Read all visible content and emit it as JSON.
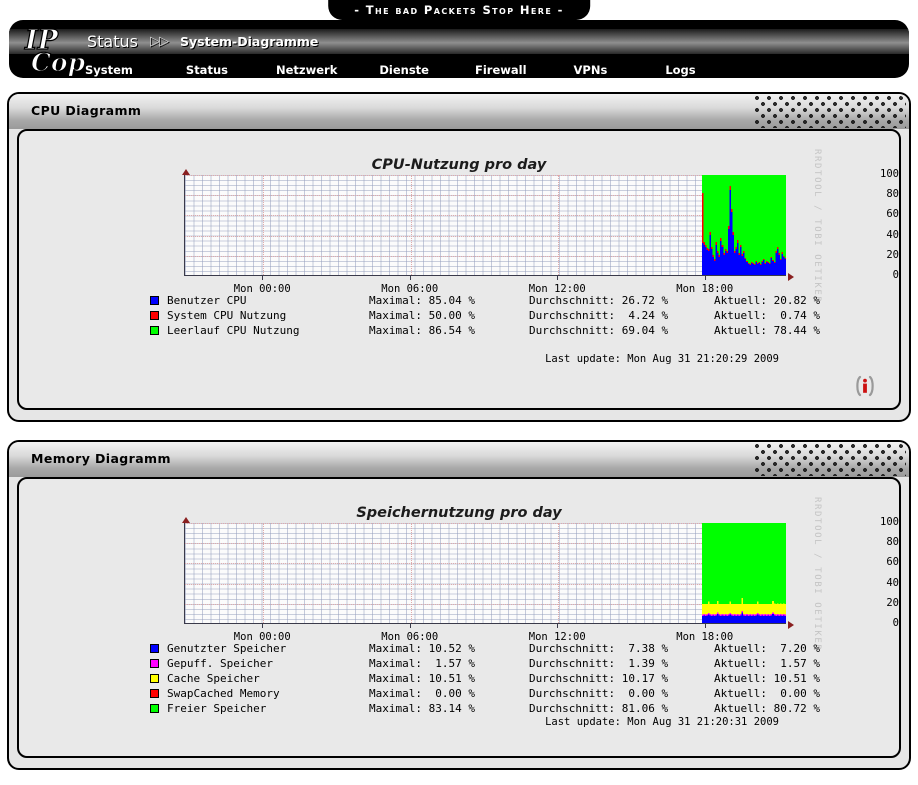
{
  "banner": {
    "tagline": "- The bad Packets Stop Here -"
  },
  "header": {
    "logo_top": "IP",
    "logo_bottom": "Cop",
    "breadcrumb_section": "Status",
    "breadcrumb_separator": "▷▷",
    "breadcrumb_page": "System-Diagramme",
    "nav": [
      {
        "label": "System"
      },
      {
        "label": "Status"
      },
      {
        "label": "Netzwerk"
      },
      {
        "label": "Dienste"
      },
      {
        "label": "Firewall"
      },
      {
        "label": "VPNs"
      },
      {
        "label": "Logs"
      }
    ]
  },
  "panels": [
    {
      "id": "cpu",
      "title": "CPU Diagramm",
      "watermark": "RRDTOOL / TOBI OETIKER",
      "last_update": "Last update: Mon Aug 31 21:20:29 2009",
      "has_info_icon": true
    },
    {
      "id": "memory",
      "title": "Memory Diagramm",
      "watermark": "RRDTOOL / TOBI OETIKER",
      "last_update": "Last update: Mon Aug 31 21:20:31 2009",
      "has_info_icon": false
    }
  ],
  "chart_data": [
    {
      "type": "area",
      "id": "cpu",
      "title": "CPU-Nutzung pro day",
      "xlabel": "",
      "ylabel": "",
      "ylim": [
        0,
        100
      ],
      "yticks": [
        0,
        20,
        40,
        60,
        80,
        100
      ],
      "xticks": [
        "Mon 00:00",
        "Mon 06:00",
        "Mon 12:00",
        "Mon 18:00"
      ],
      "xtick_positions_pct": [
        13.0,
        37.5,
        62.0,
        86.5
      ],
      "grid": true,
      "legend_position": "below",
      "legend_columns": [
        "",
        "Maximal",
        "Durchschnitt",
        "Aktuell"
      ],
      "series": [
        {
          "name": "Benutzer CPU",
          "color": "#0000ff",
          "max": "85.04",
          "avg": "26.72",
          "cur": "20.82",
          "unit": "%",
          "values": [
            32,
            30,
            28,
            25,
            24,
            40,
            26,
            18,
            14,
            30,
            22,
            18,
            34,
            28,
            20,
            24,
            22,
            46,
            85,
            63,
            40,
            22,
            26,
            32,
            20,
            28,
            19,
            22,
            16,
            13,
            11,
            10,
            12,
            11,
            10,
            13,
            11,
            12,
            10,
            13,
            15,
            11,
            13,
            12,
            11,
            17,
            14,
            12,
            22,
            26,
            20,
            15,
            21,
            18,
            16
          ]
        },
        {
          "name": "System CPU Nutzung",
          "color": "#ff0000",
          "max": "50.00",
          "avg": "4.24",
          "cur": "0.74",
          "unit": "%",
          "values": [
            50,
            3,
            2,
            2,
            2,
            3,
            2,
            2,
            2,
            3,
            2,
            2,
            3,
            2,
            2,
            2,
            2,
            3,
            4,
            3,
            3,
            2,
            2,
            3,
            2,
            2,
            2,
            2,
            1,
            1,
            1,
            1,
            1,
            1,
            1,
            1,
            1,
            1,
            1,
            1,
            1,
            1,
            1,
            1,
            1,
            1,
            1,
            1,
            2,
            2,
            2,
            1,
            2,
            1,
            1
          ]
        },
        {
          "name": "Leerlauf CPU Nutzung",
          "color": "#00ff00",
          "max": "86.54",
          "avg": "69.04",
          "cur": "78.44",
          "unit": "%",
          "values": [
            18,
            67,
            70,
            73,
            74,
            57,
            72,
            80,
            84,
            67,
            76,
            80,
            63,
            70,
            78,
            74,
            76,
            51,
            11,
            34,
            57,
            76,
            72,
            65,
            78,
            70,
            79,
            76,
            83,
            86,
            88,
            89,
            87,
            88,
            89,
            86,
            88,
            87,
            89,
            86,
            84,
            88,
            86,
            87,
            88,
            82,
            85,
            87,
            76,
            72,
            78,
            84,
            77,
            81,
            83
          ]
        }
      ],
      "data_start_pct": 86.0,
      "data_end_pct": 100.0
    },
    {
      "type": "area",
      "id": "memory",
      "title": "Speichernutzung pro day",
      "xlabel": "",
      "ylabel": "",
      "ylim": [
        0,
        100
      ],
      "yticks": [
        0,
        20,
        40,
        60,
        80,
        100
      ],
      "xticks": [
        "Mon 00:00",
        "Mon 06:00",
        "Mon 12:00",
        "Mon 18:00"
      ],
      "xtick_positions_pct": [
        13.0,
        37.5,
        62.0,
        86.5
      ],
      "grid": true,
      "legend_position": "below",
      "legend_columns": [
        "",
        "Maximal",
        "Durchschnitt",
        "Aktuell"
      ],
      "series": [
        {
          "name": "Genutzter Speicher",
          "color": "#0000ff",
          "max": "10.52",
          "avg": "7.38",
          "cur": "7.20",
          "unit": "%",
          "values": [
            7.2,
            7.3,
            7.2,
            7.4,
            8.6,
            7.3,
            7.2,
            7.3,
            7.2,
            7.4,
            8.8,
            7.3,
            7.2,
            7.3,
            7.2,
            7.3,
            7.2,
            7.4,
            8.7,
            7.3,
            7.2,
            7.3,
            7.2,
            7.3,
            7.2,
            7.4,
            10.5,
            7.3,
            7.2,
            7.3,
            7.2,
            7.3,
            7.2,
            7.3,
            7.2,
            7.4,
            8.6,
            7.3,
            7.2,
            7.3,
            7.2,
            7.3,
            7.2,
            7.3,
            7.2,
            7.4,
            8.9,
            7.3,
            7.2,
            7.3,
            7.2,
            7.3,
            7.2,
            7.3,
            7.2
          ]
        },
        {
          "name": "Gepuff. Speicher",
          "color": "#ff00ff",
          "max": "1.57",
          "avg": "1.39",
          "cur": "1.57",
          "unit": "%",
          "values": [
            1.5,
            1.5,
            1.5,
            1.5,
            1.5,
            1.5,
            1.5,
            1.5,
            1.5,
            1.5,
            1.5,
            1.5,
            1.5,
            1.5,
            1.5,
            1.5,
            1.5,
            1.5,
            1.5,
            1.5,
            1.5,
            1.5,
            1.5,
            1.5,
            1.5,
            1.5,
            1.5,
            1.5,
            1.5,
            1.5,
            1.5,
            1.5,
            1.5,
            1.5,
            1.5,
            1.5,
            1.5,
            1.5,
            1.5,
            1.5,
            1.5,
            1.5,
            1.5,
            1.5,
            1.5,
            1.5,
            1.5,
            1.5,
            1.5,
            1.5,
            1.5,
            1.5,
            1.5,
            1.5,
            1.5
          ]
        },
        {
          "name": "Cache Speicher",
          "color": "#ffff00",
          "max": "10.51",
          "avg": "10.17",
          "cur": "10.51",
          "unit": "%",
          "values": [
            10.2,
            10.2,
            10.2,
            10.2,
            11.2,
            10.2,
            10.2,
            10.2,
            10.2,
            10.2,
            11.6,
            10.2,
            10.2,
            10.2,
            10.2,
            10.2,
            10.2,
            10.2,
            11.3,
            10.2,
            10.2,
            10.2,
            10.2,
            10.2,
            10.2,
            10.2,
            12.8,
            10.2,
            10.2,
            10.2,
            10.2,
            10.2,
            10.2,
            10.2,
            10.2,
            10.2,
            11.2,
            10.2,
            10.2,
            10.2,
            10.2,
            10.2,
            10.2,
            10.2,
            10.2,
            10.2,
            11.8,
            10.5,
            10.5,
            10.5,
            10.5,
            10.5,
            10.5,
            10.5,
            10.5
          ]
        },
        {
          "name": "SwapCached Memory",
          "color": "#ff0000",
          "max": "0.00",
          "avg": "0.00",
          "cur": "0.00",
          "unit": "%",
          "values": [
            0,
            0,
            0,
            0,
            0,
            0,
            0,
            0,
            0,
            0,
            0,
            0,
            0,
            0,
            0,
            0,
            0,
            0,
            0,
            0,
            0,
            0,
            0,
            0,
            0,
            0,
            0,
            0,
            0,
            0,
            0,
            0,
            0,
            0,
            0,
            0,
            0,
            0,
            0,
            0,
            0,
            0,
            0,
            0,
            0,
            0,
            0,
            0,
            0,
            0,
            0,
            0,
            0,
            0,
            0
          ]
        },
        {
          "name": "Freier Speicher",
          "color": "#00ff00",
          "max": "83.14",
          "avg": "81.06",
          "cur": "80.72",
          "unit": "%",
          "values": [
            81.1,
            81.0,
            81.1,
            80.9,
            78.7,
            81.0,
            81.1,
            81.0,
            81.1,
            80.9,
            78.1,
            81.0,
            81.1,
            81.0,
            81.1,
            81.0,
            81.1,
            80.9,
            78.5,
            81.0,
            81.1,
            81.0,
            81.1,
            81.0,
            81.1,
            80.9,
            75.2,
            81.0,
            81.1,
            81.0,
            81.1,
            81.0,
            81.1,
            81.0,
            81.1,
            80.9,
            78.7,
            81.0,
            81.1,
            81.0,
            81.1,
            81.0,
            81.1,
            81.0,
            81.1,
            80.9,
            77.8,
            80.7,
            80.7,
            80.7,
            80.7,
            80.7,
            80.7,
            80.7,
            80.7
          ]
        }
      ],
      "data_start_pct": 86.0,
      "data_end_pct": 100.0
    }
  ],
  "legend_labels": {
    "max": "Maximal:",
    "avg": "Durchschnitt:",
    "cur": "Aktuell:"
  }
}
